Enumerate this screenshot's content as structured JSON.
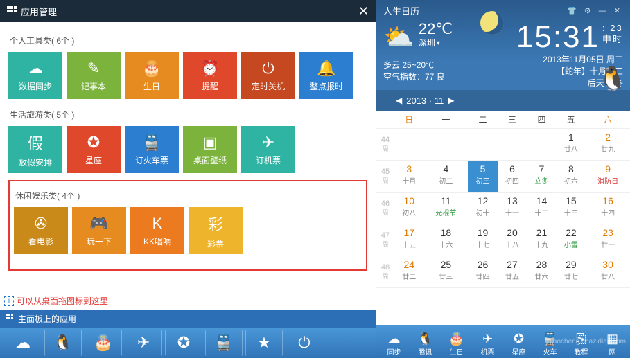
{
  "app_manager": {
    "title": "应用管理",
    "categories": [
      {
        "name": "个人工具类",
        "count_label": "( 6个 )",
        "highlight": false,
        "tiles": [
          {
            "label": "数据同步",
            "color": "#2fb4a3",
            "icon": "☁"
          },
          {
            "label": "记事本",
            "color": "#7bb33d",
            "icon": "✎"
          },
          {
            "label": "生日",
            "color": "#e58b1f",
            "icon": "🎂"
          },
          {
            "label": "提醒",
            "color": "#e0482c",
            "icon": "⏰"
          },
          {
            "label": "定时关机",
            "color": "#c54820",
            "icon": "⏻"
          },
          {
            "label": "整点报时",
            "color": "#2c7fd0",
            "icon": "🔔"
          }
        ]
      },
      {
        "name": "生活旅游类",
        "count_label": "( 5个 )",
        "highlight": false,
        "tiles": [
          {
            "label": "放假安排",
            "color": "#2fb4a3",
            "icon": "假"
          },
          {
            "label": "星座",
            "color": "#e0482c",
            "icon": "✪"
          },
          {
            "label": "订火车票",
            "color": "#2c7fd0",
            "icon": "🚆"
          },
          {
            "label": "桌面壁纸",
            "color": "#7bb33d",
            "icon": "▣"
          },
          {
            "label": "订机票",
            "color": "#2fb4a3",
            "icon": "✈"
          }
        ]
      },
      {
        "name": "休闲娱乐类",
        "count_label": "( 4个 )",
        "highlight": true,
        "tiles": [
          {
            "label": "看电影",
            "color": "#c98a1a",
            "icon": "✇"
          },
          {
            "label": "玩一下",
            "color": "#e58b1f",
            "icon": "🎮"
          },
          {
            "label": "KK唱响",
            "color": "#ec7a1e",
            "icon": "K"
          },
          {
            "label": "彩票",
            "color": "#eeb42c",
            "icon": "彩"
          }
        ]
      }
    ],
    "drop_hint": "可以从桌面拖图标到这里",
    "main_bar_label": "主面板上的应用",
    "dock_icons": [
      "cloud",
      "penguin",
      "cake",
      "plane",
      "star",
      "train",
      "star2",
      "power"
    ]
  },
  "calendar_panel": {
    "title": "人生日历",
    "temperature": "22℃",
    "city": "深圳",
    "forecast": "多云 25~20℃",
    "aqi": "空气指数：77 良",
    "time": "15:31",
    "time_sec": "23",
    "time_suffix": "申时",
    "date_label": "2013年11月05日 周二",
    "lunar_label": "【蛇年】十月初三",
    "solar_term": "后天 立冬",
    "month_label": "2013 · 11",
    "weekdays": [
      "日",
      "一",
      "二",
      "三",
      "四",
      "五",
      "六"
    ],
    "week_col_label": "周",
    "weeks": [
      {
        "wk": "44",
        "days": [
          null,
          null,
          null,
          null,
          null,
          {
            "n": "1",
            "l": "廿八"
          },
          {
            "n": "2",
            "l": "廿九"
          }
        ]
      },
      {
        "wk": "45",
        "days": [
          {
            "n": "3",
            "l": "十月"
          },
          {
            "n": "4",
            "l": "初二"
          },
          {
            "n": "5",
            "l": "初三",
            "today": true
          },
          {
            "n": "6",
            "l": "初四"
          },
          {
            "n": "7",
            "l": "立冬",
            "g": true
          },
          {
            "n": "8",
            "l": "初六"
          },
          {
            "n": "9",
            "l": "消防日",
            "r": true
          }
        ]
      },
      {
        "wk": "46",
        "days": [
          {
            "n": "10",
            "l": "初八"
          },
          {
            "n": "11",
            "l": "光棍节",
            "g": true
          },
          {
            "n": "12",
            "l": "初十"
          },
          {
            "n": "13",
            "l": "十一"
          },
          {
            "n": "14",
            "l": "十二"
          },
          {
            "n": "15",
            "l": "十三"
          },
          {
            "n": "16",
            "l": "十四"
          }
        ]
      },
      {
        "wk": "47",
        "days": [
          {
            "n": "17",
            "l": "十五"
          },
          {
            "n": "18",
            "l": "十六"
          },
          {
            "n": "19",
            "l": "十七"
          },
          {
            "n": "20",
            "l": "十八"
          },
          {
            "n": "21",
            "l": "十九"
          },
          {
            "n": "22",
            "l": "小雪",
            "g": true
          },
          {
            "n": "23",
            "l": "廿一"
          }
        ]
      },
      {
        "wk": "48",
        "days": [
          {
            "n": "24",
            "l": "廿二"
          },
          {
            "n": "25",
            "l": "廿三"
          },
          {
            "n": "26",
            "l": "廿四"
          },
          {
            "n": "27",
            "l": "廿五"
          },
          {
            "n": "28",
            "l": "廿六"
          },
          {
            "n": "29",
            "l": "廿七"
          },
          {
            "n": "30",
            "l": "廿八"
          }
        ]
      }
    ],
    "dock": [
      {
        "label": "同步",
        "icon": "☁"
      },
      {
        "label": "腾讯",
        "icon": "🐧"
      },
      {
        "label": "生日",
        "icon": "🎂"
      },
      {
        "label": "机票",
        "icon": "✈"
      },
      {
        "label": "星座",
        "icon": "✪"
      },
      {
        "label": "火车",
        "icon": "🚆"
      },
      {
        "label": "教程",
        "icon": "⎘"
      },
      {
        "label": "网",
        "icon": "▦"
      }
    ],
    "watermark": "jiaocheng.chazidian.com"
  }
}
